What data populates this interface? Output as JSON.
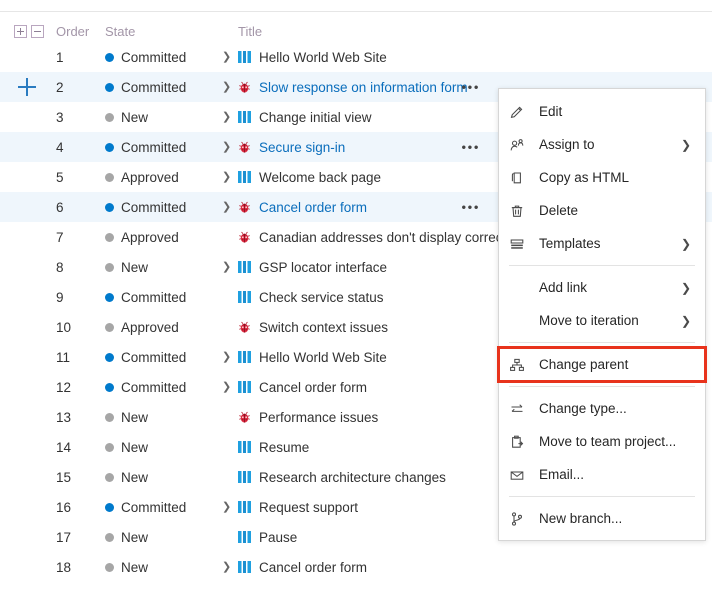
{
  "grid": {
    "columns": {
      "expand": "",
      "order": "Order",
      "state": "State",
      "title": "Title"
    },
    "header_icons": {
      "expand_all": "expand-all-icon",
      "collapse_all": "collapse-all-icon"
    },
    "rows": [
      {
        "order": "1",
        "state": "Committed",
        "state_color": "#007acc",
        "title": "Hello World Web Site",
        "type": "pbi",
        "chevron": true,
        "link": false,
        "ellipsis": false,
        "selected": false,
        "plus": false
      },
      {
        "order": "2",
        "state": "Committed",
        "state_color": "#007acc",
        "title": "Slow response on information form",
        "type": "bug",
        "chevron": true,
        "link": true,
        "ellipsis": true,
        "selected": true,
        "plus": true
      },
      {
        "order": "3",
        "state": "New",
        "state_color": "#a6a6a6",
        "title": "Change initial view",
        "type": "pbi",
        "chevron": true,
        "link": false,
        "ellipsis": false,
        "selected": false,
        "plus": false
      },
      {
        "order": "4",
        "state": "Committed",
        "state_color": "#007acc",
        "title": "Secure sign-in",
        "type": "bug",
        "chevron": true,
        "link": true,
        "ellipsis": true,
        "selected": true,
        "plus": false
      },
      {
        "order": "5",
        "state": "Approved",
        "state_color": "#a6a6a6",
        "title": "Welcome back page",
        "type": "pbi",
        "chevron": true,
        "link": false,
        "ellipsis": false,
        "selected": false,
        "plus": false
      },
      {
        "order": "6",
        "state": "Committed",
        "state_color": "#007acc",
        "title": "Cancel order form",
        "type": "bug",
        "chevron": true,
        "link": true,
        "ellipsis": true,
        "selected": true,
        "plus": false
      },
      {
        "order": "7",
        "state": "Approved",
        "state_color": "#a6a6a6",
        "title": "Canadian addresses don't display correctly",
        "type": "bug",
        "chevron": false,
        "link": false,
        "ellipsis": false,
        "selected": false,
        "plus": false
      },
      {
        "order": "8",
        "state": "New",
        "state_color": "#a6a6a6",
        "title": "GSP locator interface",
        "type": "pbi",
        "chevron": true,
        "link": false,
        "ellipsis": false,
        "selected": false,
        "plus": false
      },
      {
        "order": "9",
        "state": "Committed",
        "state_color": "#007acc",
        "title": "Check service status",
        "type": "pbi",
        "chevron": false,
        "link": false,
        "ellipsis": false,
        "selected": false,
        "plus": false
      },
      {
        "order": "10",
        "state": "Approved",
        "state_color": "#a6a6a6",
        "title": "Switch context issues",
        "type": "bug",
        "chevron": false,
        "link": false,
        "ellipsis": false,
        "selected": false,
        "plus": false
      },
      {
        "order": "11",
        "state": "Committed",
        "state_color": "#007acc",
        "title": "Hello World Web Site",
        "type": "pbi",
        "chevron": true,
        "link": false,
        "ellipsis": false,
        "selected": false,
        "plus": false
      },
      {
        "order": "12",
        "state": "Committed",
        "state_color": "#007acc",
        "title": "Cancel order form",
        "type": "pbi",
        "chevron": true,
        "link": false,
        "ellipsis": false,
        "selected": false,
        "plus": false
      },
      {
        "order": "13",
        "state": "New",
        "state_color": "#a6a6a6",
        "title": "Performance issues",
        "type": "bug",
        "chevron": false,
        "link": false,
        "ellipsis": false,
        "selected": false,
        "plus": false
      },
      {
        "order": "14",
        "state": "New",
        "state_color": "#a6a6a6",
        "title": "Resume",
        "type": "pbi",
        "chevron": false,
        "link": false,
        "ellipsis": false,
        "selected": false,
        "plus": false
      },
      {
        "order": "15",
        "state": "New",
        "state_color": "#a6a6a6",
        "title": "Research architecture changes",
        "type": "pbi",
        "chevron": false,
        "link": false,
        "ellipsis": false,
        "selected": false,
        "plus": false
      },
      {
        "order": "16",
        "state": "Committed",
        "state_color": "#007acc",
        "title": "Request support",
        "type": "pbi",
        "chevron": true,
        "link": false,
        "ellipsis": false,
        "selected": false,
        "plus": false
      },
      {
        "order": "17",
        "state": "New",
        "state_color": "#a6a6a6",
        "title": "Pause",
        "type": "pbi",
        "chevron": false,
        "link": false,
        "ellipsis": false,
        "selected": false,
        "plus": false
      },
      {
        "order": "18",
        "state": "New",
        "state_color": "#a6a6a6",
        "title": "Cancel order form",
        "type": "pbi",
        "chevron": true,
        "link": false,
        "ellipsis": false,
        "selected": false,
        "plus": false
      }
    ],
    "ellipsis_label": "•••",
    "chevron_glyph": "❯"
  },
  "context_menu": {
    "highlight_color": "#e8331c",
    "submenu_chevron": "❯",
    "items": [
      {
        "label": "Edit",
        "icon": "pencil-icon",
        "submenu": false,
        "separator_after": false,
        "highlighted": false
      },
      {
        "label": "Assign to",
        "icon": "assign-person-icon",
        "submenu": true,
        "separator_after": false,
        "highlighted": false
      },
      {
        "label": "Copy as HTML",
        "icon": "copy-icon",
        "submenu": false,
        "separator_after": false,
        "highlighted": false
      },
      {
        "label": "Delete",
        "icon": "trash-icon",
        "submenu": false,
        "separator_after": false,
        "highlighted": false
      },
      {
        "label": "Templates",
        "icon": "templates-icon",
        "submenu": true,
        "separator_after": true,
        "highlighted": false
      },
      {
        "label": "Add link",
        "icon": "none",
        "submenu": true,
        "separator_after": false,
        "highlighted": false
      },
      {
        "label": "Move to iteration",
        "icon": "none",
        "submenu": true,
        "separator_after": true,
        "highlighted": false
      },
      {
        "label": "Change parent",
        "icon": "hierarchy-icon",
        "submenu": false,
        "separator_after": true,
        "highlighted": true
      },
      {
        "label": "Change type...",
        "icon": "swap-arrows-icon",
        "submenu": false,
        "separator_after": false,
        "highlighted": false
      },
      {
        "label": "Move to team project...",
        "icon": "clipboard-move-icon",
        "submenu": false,
        "separator_after": false,
        "highlighted": false
      },
      {
        "label": "Email...",
        "icon": "envelope-icon",
        "submenu": false,
        "separator_after": true,
        "highlighted": false
      },
      {
        "label": "New branch...",
        "icon": "branch-icon",
        "submenu": false,
        "separator_after": false,
        "highlighted": false
      }
    ]
  }
}
